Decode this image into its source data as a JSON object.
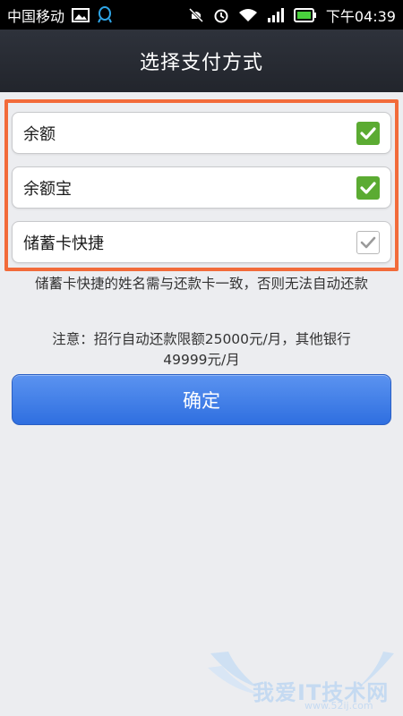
{
  "status_bar": {
    "carrier": "中国移动",
    "time": "下午04:39",
    "icons": [
      "image-icon",
      "qq-icon",
      "mute-icon",
      "alarm-icon",
      "wifi-icon",
      "signal-icon",
      "battery-icon"
    ]
  },
  "header": {
    "title": "选择支付方式"
  },
  "payment_options": [
    {
      "label": "余额",
      "checked": true,
      "icon": "checked-checkbox-icon"
    },
    {
      "label": "余额宝",
      "checked": true,
      "icon": "checked-checkbox-icon"
    },
    {
      "label": "储蓄卡快捷",
      "checked": true,
      "icon": "disabled-checkbox-icon"
    }
  ],
  "notes": {
    "card_name_notice": "储蓄卡快捷的姓名需与还款卡一致，否则无法自动还款",
    "limit_line1": "注意：招行自动还款限额25000元/月，其他银行",
    "limit_line2": "49999元/月"
  },
  "confirm_button": {
    "label": "确定"
  },
  "watermark": {
    "text": "我爱IT技术网",
    "url": "www.52ij.com"
  },
  "colors": {
    "header_bg": "#2a2d35",
    "check_green": "#5bab32",
    "highlight_orange": "#f26b3a",
    "button_blue": "#3f7ee6"
  }
}
